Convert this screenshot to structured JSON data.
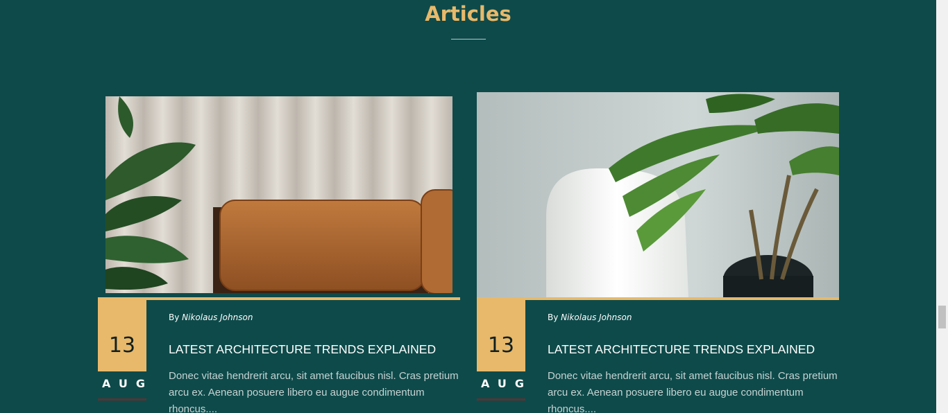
{
  "section": {
    "title": "Articles"
  },
  "articles": [
    {
      "image_icon": "sofa-curtain-photo",
      "day": "13",
      "month": "AUG",
      "by_label": "By",
      "author": "Nikolaus Johnson",
      "title": "LATEST ARCHITECTURE TRENDS EXPLAINED",
      "excerpt": "Donec vitae hendrerit arcu, sit amet faucibus nisl. Cras pretium arcu ex. Aenean posuere libero eu augue condimentum rhoncus...."
    },
    {
      "image_icon": "chair-palm-photo",
      "day": "13",
      "month": "AUG",
      "by_label": "By",
      "author": "Nikolaus Johnson",
      "title": "LATEST ARCHITECTURE TRENDS EXPLAINED",
      "excerpt": "Donec vitae hendrerit arcu, sit amet faucibus nisl. Cras pretium arcu ex. Aenean posuere libero eu augue condimentum rhoncus...."
    }
  ],
  "colors": {
    "background": "#0e4a4a",
    "accent": "#e8b96a",
    "text": "#ffffff",
    "muted_text": "#c7d3d3"
  }
}
